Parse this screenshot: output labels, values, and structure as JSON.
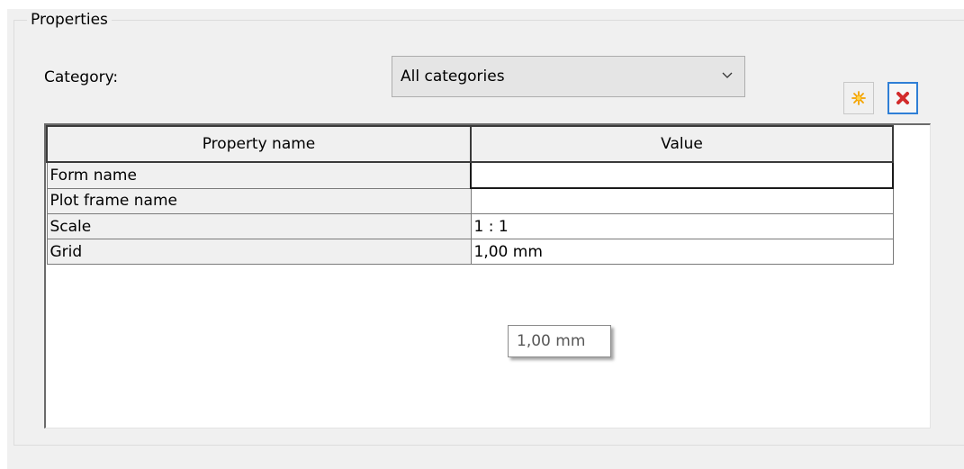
{
  "group": {
    "title": "Properties"
  },
  "category": {
    "label": "Category:",
    "selected": "All categories"
  },
  "toolbar": {
    "new_icon": "new-sparkle-icon",
    "delete_icon": "delete-x-icon",
    "new_color": "#f4a300",
    "delete_color": "#d22b2b"
  },
  "grid": {
    "columns": [
      "Property name",
      "Value"
    ],
    "rows": [
      {
        "name": "Form name",
        "value": ""
      },
      {
        "name": "Plot frame name",
        "value": ""
      },
      {
        "name": "Scale",
        "value": "1 : 1"
      },
      {
        "name": "Grid",
        "value": "1,00 mm"
      }
    ]
  },
  "tooltip": {
    "text": "1,00 mm"
  }
}
